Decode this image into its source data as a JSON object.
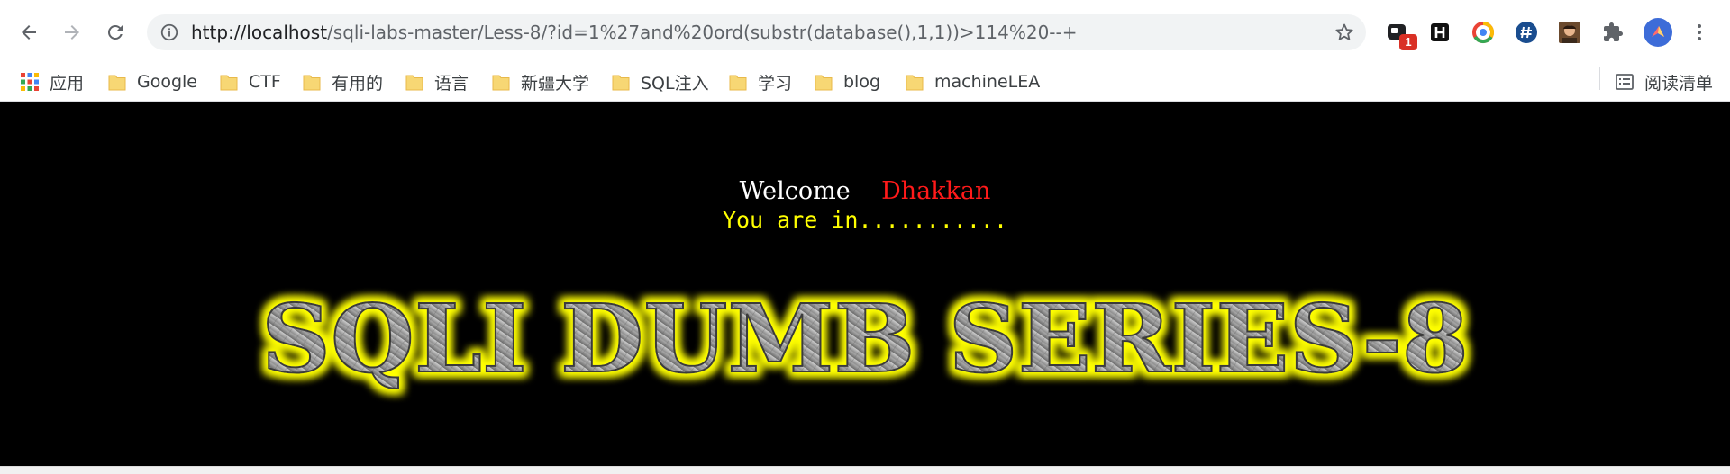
{
  "browser": {
    "url_host": "http://localhost",
    "url_path": "/sqli-labs-master/Less-8/?id=1%27and%20ord(substr(database(),1,1))>114%20--+",
    "extension_badge": "1",
    "extension_icons": [
      "extension-with-badge-icon",
      "h-icon",
      "chrome-ring-icon",
      "hash-icon",
      "avatar-photo-icon",
      "puzzle-icon",
      "profile-icon",
      "kebab-menu-icon"
    ]
  },
  "bookmarks": {
    "apps_label": "应用",
    "items": [
      {
        "label": "Google"
      },
      {
        "label": "CTF"
      },
      {
        "label": "有用的"
      },
      {
        "label": "语言"
      },
      {
        "label": "新疆大学"
      },
      {
        "label": "SQL注入"
      },
      {
        "label": "学习"
      },
      {
        "label": "blog"
      },
      {
        "label": "machineLEA"
      }
    ],
    "reading_list_label": "阅读清单"
  },
  "page": {
    "welcome": "Welcome",
    "name": "Dhakkan",
    "status": "You are in...........",
    "title_image_text": "SQLI DUMB SERIES-8"
  },
  "colors": {
    "page_background": "#000000",
    "welcome_text": "#ffffff",
    "name_text": "#ff1a1a",
    "status_text": "#ffff00",
    "title_glow": "#ffff00"
  }
}
